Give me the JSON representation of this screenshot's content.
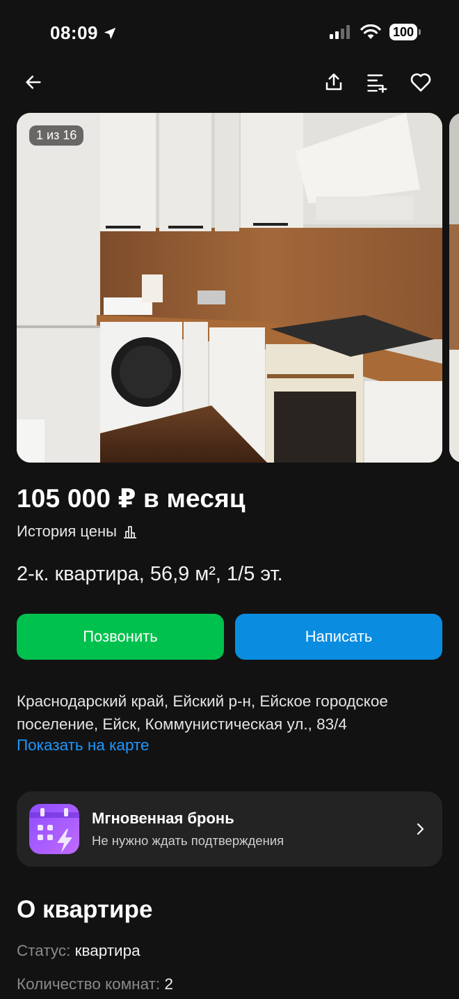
{
  "status_bar": {
    "time": "08:09",
    "battery": "100"
  },
  "gallery": {
    "counter": "1 из 16"
  },
  "listing": {
    "price": "105 000 ₽ в месяц",
    "price_history_label": "История цены",
    "title": "2-к. квартира, 56,9 м², 1/5 эт."
  },
  "actions": {
    "call_label": "Позвонить",
    "write_label": "Написать"
  },
  "location": {
    "address": "Краснодарский край, Ейский р-н, Ейское городское поселение, Ейск, Коммунистическая ул., 83/4",
    "map_link": "Показать на карте"
  },
  "instant_booking": {
    "title": "Мгновенная бронь",
    "subtitle": "Не нужно ждать подтверждения"
  },
  "about": {
    "title": "О квартире",
    "params": [
      {
        "key": "Статус:",
        "value": "квартира"
      },
      {
        "key": "Количество комнат:",
        "value": "2"
      }
    ]
  },
  "colors": {
    "background": "#121212",
    "call": "#00c14d",
    "write": "#0a8de0",
    "link": "#1e97ff",
    "promo_accent": "#a35cff"
  },
  "icons": [
    "location-arrow-icon",
    "signal-icon",
    "wifi-icon",
    "back-arrow-icon",
    "share-icon",
    "compare-icon",
    "heart-icon",
    "price-chart-icon",
    "instant-booking-icon",
    "chevron-right-icon"
  ]
}
